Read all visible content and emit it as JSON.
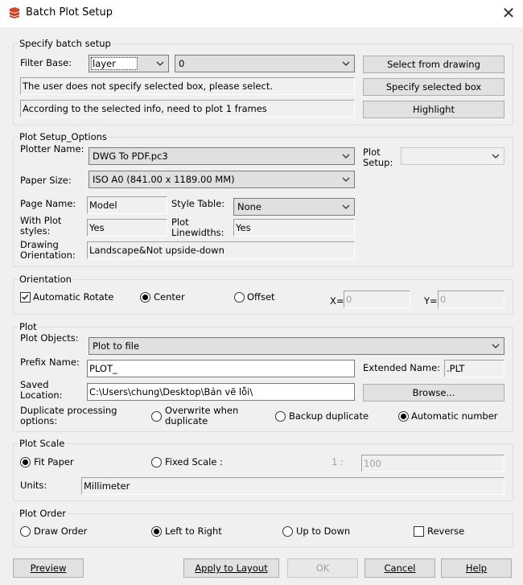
{
  "window": {
    "title": "Batch Plot Setup"
  },
  "batch": {
    "group_label": "Specify batch setup",
    "filter_base_label": "Filter Base:",
    "filter_base_value": "layer",
    "filter_value": "0",
    "info_line1": "The user does not specify selected box, please select.",
    "info_line2": "According to the selected info, need to plot 1 frames",
    "select_from_drawing": "Select from drawing",
    "specify_selected_box": "Specify selected box",
    "highlight": "Highlight"
  },
  "plot_setup": {
    "group_label": "Plot Setup_Options",
    "plotter_name_label": "Plotter Name:",
    "plotter_name": "DWG To PDF.pc3",
    "plot_setup_label_1": "Plot",
    "plot_setup_label_2": "Setup:",
    "plot_setup_value": "",
    "paper_size_label": "Paper Size:",
    "paper_size": "ISO A0 (841.00 x 1189.00 MM)",
    "page_name_label": "Page Name:",
    "page_name": "Model",
    "style_table_label": "Style Table:",
    "style_table": "None",
    "with_plot_styles_label_1": "With Plot",
    "with_plot_styles_label_2": "styles:",
    "with_plot_styles": "Yes",
    "plot_lineweights_label_1": "Plot",
    "plot_lineweights_label_2": "Linewidths:",
    "plot_lineweights": "Yes",
    "drawing_orientation_label_1": "Drawing",
    "drawing_orientation_label_2": "Orientation:",
    "drawing_orientation": "Landscape&Not upside-down"
  },
  "orientation": {
    "group_label": "Orientation",
    "automatic_rotate": "Automatic Rotate",
    "center": "Center",
    "offset": "Offset",
    "x_label": "X=",
    "x_value": "0",
    "y_label": "Y=",
    "y_value": "0"
  },
  "plot": {
    "group_label": "Plot",
    "plot_objects_label": "Plot Objects:",
    "plot_objects": "Plot to file",
    "prefix_name_label": "Prefix Name:",
    "prefix_name": "PLOT_",
    "extended_name_label": "Extended Name:",
    "extended_name": ".PLT",
    "saved_location_label_1": "Saved",
    "saved_location_label_2": "Location:",
    "saved_location": "C:\\Users\\chung\\Desktop\\Bản vẽ lỗi\\",
    "browse": "Browse...",
    "duplicate_label_1": "Duplicate processing",
    "duplicate_label_2": "options:",
    "overwrite_1": "Overwrite when",
    "overwrite_2": "duplicate",
    "backup_duplicate": "Backup duplicate",
    "automatic_number": "Automatic number"
  },
  "plot_scale": {
    "group_label": "Plot Scale",
    "fit_paper": "Fit Paper",
    "fixed_scale": "Fixed Scale :",
    "ratio_prefix": "1 :",
    "ratio_value": "100",
    "units_label": "Units:",
    "units_value": "Millimeter"
  },
  "plot_order": {
    "group_label": "Plot Order",
    "draw_order": "Draw Order",
    "left_to_right": "Left to Right",
    "up_to_down": "Up to Down",
    "reverse": "Reverse"
  },
  "buttons": {
    "preview": "Preview",
    "apply_to_layout": "Apply to Layout",
    "ok": "OK",
    "cancel": "Cancel",
    "help": "Help"
  },
  "colors": {
    "app_icon": "#e2401c"
  }
}
